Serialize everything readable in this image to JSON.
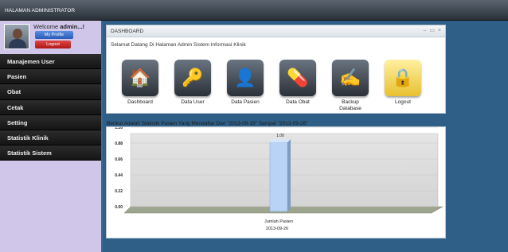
{
  "app": {
    "title": "HALAMAN ADMINISTRATOR"
  },
  "user": {
    "welcome_prefix": "Welcome",
    "username": "admin...!",
    "profile_button": "My Profile",
    "logout_button": "Logout"
  },
  "sidebar": {
    "items": [
      {
        "label": "Manajemen User"
      },
      {
        "label": "Pasien"
      },
      {
        "label": "Obat"
      },
      {
        "label": "Cetak"
      },
      {
        "label": "Setting"
      },
      {
        "label": "Statistik Klinik"
      },
      {
        "label": "Statistik Sistem"
      }
    ]
  },
  "dashboard": {
    "title": "DASHBOARD",
    "controls": "– ▭ ×",
    "welcome_message": "Selamat Datang Di Halaman Admin Sistem Informasi Klinik",
    "tiles": [
      {
        "label": "Dashboard",
        "icon": "house-icon"
      },
      {
        "label": "Data User",
        "icon": "key-user-icon"
      },
      {
        "label": "Data Pasien",
        "icon": "patient-icon"
      },
      {
        "label": "Data Obat",
        "icon": "medicine-icon"
      },
      {
        "label": "Backup Database",
        "icon": "backup-icon"
      },
      {
        "label": "Logout",
        "icon": "lock-icon"
      }
    ]
  },
  "statistics": {
    "heading": "Berikut Adalah Statistik Pasien Yang Mendaftar Dari \"2013-09-19\" Sampai \"2013-09-26\""
  },
  "chart_data": {
    "type": "bar",
    "categories": [
      "Jumlah Pasien"
    ],
    "series": [
      {
        "name": "2013-09-26",
        "values": [
          1.0
        ]
      }
    ],
    "data_labels": [
      "1.00"
    ],
    "yticks": [
      "1.10",
      "0.88",
      "0.66",
      "0.44",
      "0.22",
      "0.00"
    ],
    "ylim": [
      0,
      1.1
    ],
    "legend": "2013-09-26",
    "grid": true,
    "colors": {
      "bar": "#b9d3f7",
      "bar_side": "#7f9cc2",
      "floor": "#9ea58e"
    }
  }
}
